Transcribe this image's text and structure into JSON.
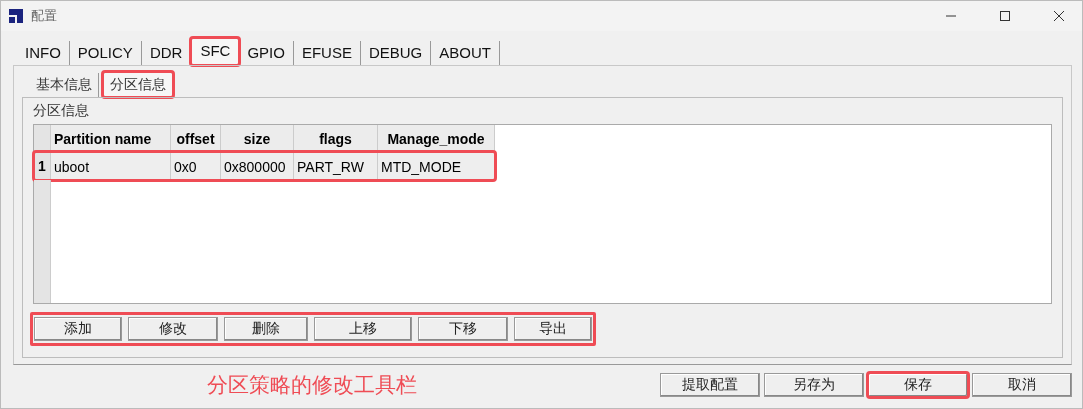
{
  "window": {
    "title": "配置"
  },
  "tabs": [
    {
      "label": "INFO",
      "selected": false,
      "highlighted": false
    },
    {
      "label": "POLICY",
      "selected": false,
      "highlighted": false
    },
    {
      "label": "DDR",
      "selected": false,
      "highlighted": false
    },
    {
      "label": "SFC",
      "selected": true,
      "highlighted": true
    },
    {
      "label": "GPIO",
      "selected": false,
      "highlighted": false
    },
    {
      "label": "EFUSE",
      "selected": false,
      "highlighted": false
    },
    {
      "label": "DEBUG",
      "selected": false,
      "highlighted": false
    },
    {
      "label": "ABOUT",
      "selected": false,
      "highlighted": false
    }
  ],
  "sub_tabs": [
    {
      "label": "基本信息",
      "selected": false,
      "highlighted": false
    },
    {
      "label": "分区信息",
      "selected": true,
      "highlighted": true
    }
  ],
  "group": {
    "title": "分区信息"
  },
  "table": {
    "columns": [
      "Partition name",
      "offset",
      "size",
      "flags",
      "Manage_mode"
    ],
    "rows": [
      {
        "number": "1",
        "cells": [
          "uboot",
          "0x0",
          "0x800000",
          "PART_RW",
          "MTD_MODE"
        ],
        "highlighted": true
      }
    ]
  },
  "toolbar": {
    "highlighted": true,
    "buttons": [
      "添加",
      "修改",
      "删除",
      "上移",
      "下移",
      "导出"
    ]
  },
  "annotation": "分区策略的修改工具栏",
  "footer_buttons": [
    {
      "label": "提取配置",
      "highlighted": false
    },
    {
      "label": "另存为",
      "highlighted": false
    },
    {
      "label": "保存",
      "highlighted": true
    },
    {
      "label": "取消",
      "highlighted": false
    }
  ]
}
